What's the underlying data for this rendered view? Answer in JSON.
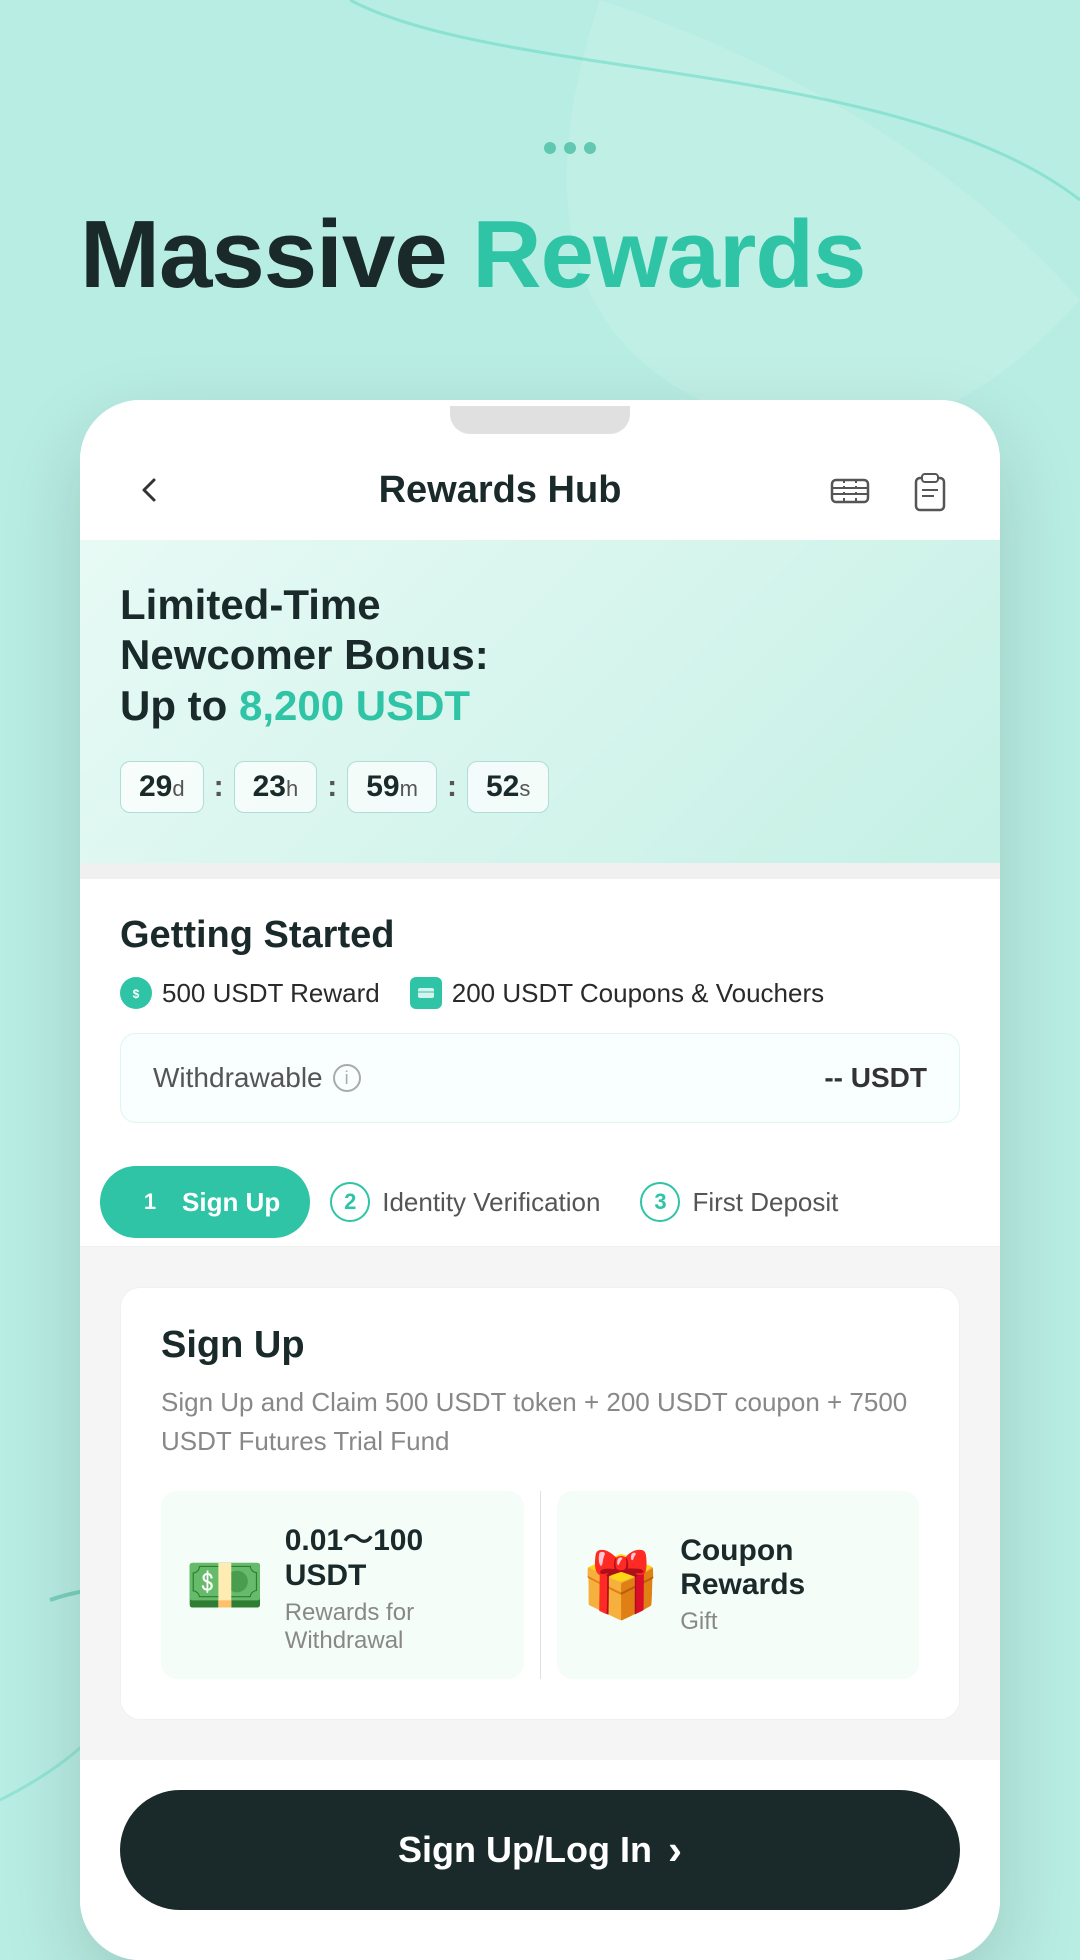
{
  "page": {
    "background_color": "#b8ede3"
  },
  "hero": {
    "prefix": "Massive ",
    "highlight": "Rewards"
  },
  "nav": {
    "title": "Rewards Hub",
    "back_label": "←"
  },
  "banner": {
    "line1": "Limited-Time",
    "line2": "Newcomer Bonus:",
    "amount_prefix": "Up to ",
    "amount": "8,200 USDT",
    "timer": {
      "days": "29",
      "days_unit": "d",
      "hours": "23",
      "hours_unit": "h",
      "minutes": "59",
      "minutes_unit": "m",
      "seconds": "52",
      "seconds_unit": "s"
    }
  },
  "getting_started": {
    "title": "Getting Started",
    "rewards": [
      {
        "label": "500 USDT Reward",
        "icon_type": "circle"
      },
      {
        "label": "200 USDT Coupons & Vouchers",
        "icon_type": "rect"
      }
    ],
    "withdrawable": {
      "label": "Withdrawable",
      "value": "-- USDT"
    }
  },
  "tabs": [
    {
      "number": "1",
      "label": "Sign Up",
      "active": true
    },
    {
      "number": "2",
      "label": "Identity Verification",
      "active": false
    },
    {
      "number": "3",
      "label": "First Deposit",
      "active": false
    }
  ],
  "signup_section": {
    "title": "Sign Up",
    "description": "Sign Up and Claim 500 USDT token + 200 USDT coupon + 7500 USDT Futures Trial Fund",
    "reward_cards": [
      {
        "emoji": "💵",
        "amount": "0.01～100\nUSDT",
        "desc": "Rewards for\nWithdrawal"
      },
      {
        "emoji": "🎁",
        "amount": "Coupon\nRewards",
        "desc": "Gift"
      }
    ]
  },
  "cta": {
    "label": "Sign Up/Log In",
    "arrow": "›"
  }
}
